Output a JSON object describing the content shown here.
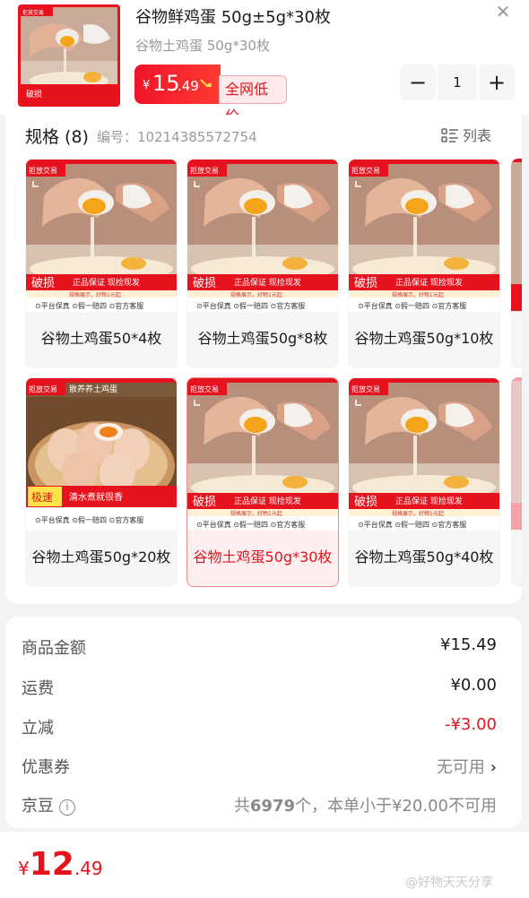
{
  "header": {
    "title": "谷物鲜鸡蛋 50g±5g*30枚",
    "subtitle": "谷物土鸡蛋 50g*30枚",
    "price_symbol": "¥",
    "price_int": "15",
    "price_cents": ".49",
    "price_tag": "全网低价",
    "close_icon": "close-icon",
    "quantity": "1",
    "minus_label": "−",
    "plus_label": "+"
  },
  "thumb": {
    "brand_text": "拒放交易",
    "badge_text": "破损",
    "line1": "正品保证 现捡现发",
    "line2": "平台保真",
    "line3": "假一赔四",
    "line4": "官方客服"
  },
  "spec": {
    "heading": "规格 (8)",
    "code_label": "编号：10214385572754",
    "list_label": "列表",
    "items": [
      {
        "label": "谷物土鸡蛋50*4枚",
        "selected": false,
        "image": "cracked-egg"
      },
      {
        "label": "谷物土鸡蛋50g*8枚",
        "selected": false,
        "image": "cracked-egg"
      },
      {
        "label": "谷物土鸡蛋50g*10枚",
        "selected": false,
        "image": "cracked-egg"
      },
      {
        "label": "谷物土鸡蛋50g*20枚",
        "selected": false,
        "image": "egg-basket"
      },
      {
        "label": "谷物土鸡蛋50g*30枚",
        "selected": true,
        "image": "cracked-egg"
      },
      {
        "label": "谷物土鸡蛋50g*40枚",
        "selected": false,
        "image": "cracked-egg"
      }
    ],
    "card_overlay": {
      "brand": "拒放交易",
      "badge": "破损",
      "promo": "正品保证 现捡现发",
      "promo_sub": "规格展示，好物1元起",
      "feature1": "平台保真",
      "feature2": "假一赔四",
      "feature3": "官方客服",
      "basket_top": "散养养土鸡蛋",
      "basket_badge": "极速",
      "basket_promo": "清水煮就很香"
    }
  },
  "summary": {
    "rows": [
      {
        "key": "商品金额",
        "value": "¥15.49"
      },
      {
        "key": "运费",
        "value": "¥0.00"
      },
      {
        "key": "立减",
        "value": "-¥3.00"
      },
      {
        "key": "优惠券",
        "value": "无可用"
      },
      {
        "key": "京豆",
        "value_prefix": "共",
        "value_bold": "6979",
        "value_suffix": "个，本单小于¥20.00不可用"
      }
    ]
  },
  "footer": {
    "symbol": "¥",
    "int": "12",
    "cents": ".49",
    "watermark": "@好物天天分享"
  },
  "colors": {
    "accent": "#e6121d",
    "tag_bg": "#ffe9ea",
    "page_bg": "#f2f3f5"
  }
}
